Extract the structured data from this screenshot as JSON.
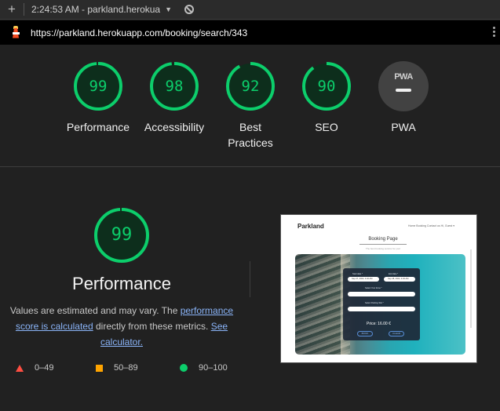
{
  "browser": {
    "new_tab_label": "+",
    "tab_title": "2:24:53 AM - parkland.herokua",
    "url": "https://parkland.herokuapp.com/booking/search/343"
  },
  "scores": [
    {
      "value": "99",
      "label": "Performance",
      "fraction": 0.99
    },
    {
      "value": "98",
      "label": "Accessibility",
      "fraction": 0.98
    },
    {
      "value": "92",
      "label": "Best Practices",
      "fraction": 0.92
    },
    {
      "value": "90",
      "label": "SEO",
      "fraction": 0.9
    }
  ],
  "pwa": {
    "badge": "PWA",
    "label": "PWA"
  },
  "detail": {
    "score": "99",
    "fraction": 0.99,
    "title": "Performance",
    "desc_before": "Values are estimated and may vary. The ",
    "link_score": "performance score is calculated",
    "desc_middle": " directly from these metrics. ",
    "link_calc": "See calculator."
  },
  "legend": {
    "fail": "0–49",
    "average": "50–89",
    "pass": "90–100"
  },
  "thumbnail": {
    "brand": "Parkland",
    "nav": "Home  Booking  Contact us  Hi, Guest ▾",
    "heading": "Booking Page",
    "subheading": "The best booking service for you!",
    "start_label": "Start date *",
    "start_value": "Sep 27, 2022, 4:46 AM",
    "end_label": "End date *",
    "end_value": "Sep 28, 2022, 4:46 AM",
    "zone_label": "Select Your Zone *",
    "spot_label": "Select Parking Slot *",
    "price": "Price: 16.00 €",
    "btn_left": "BOOK",
    "btn_right": "CLEAR"
  },
  "colors": {
    "pass": "#0cce6b",
    "average": "#ffa400",
    "fail": "#ff4e42",
    "link": "#8ab4f8"
  }
}
